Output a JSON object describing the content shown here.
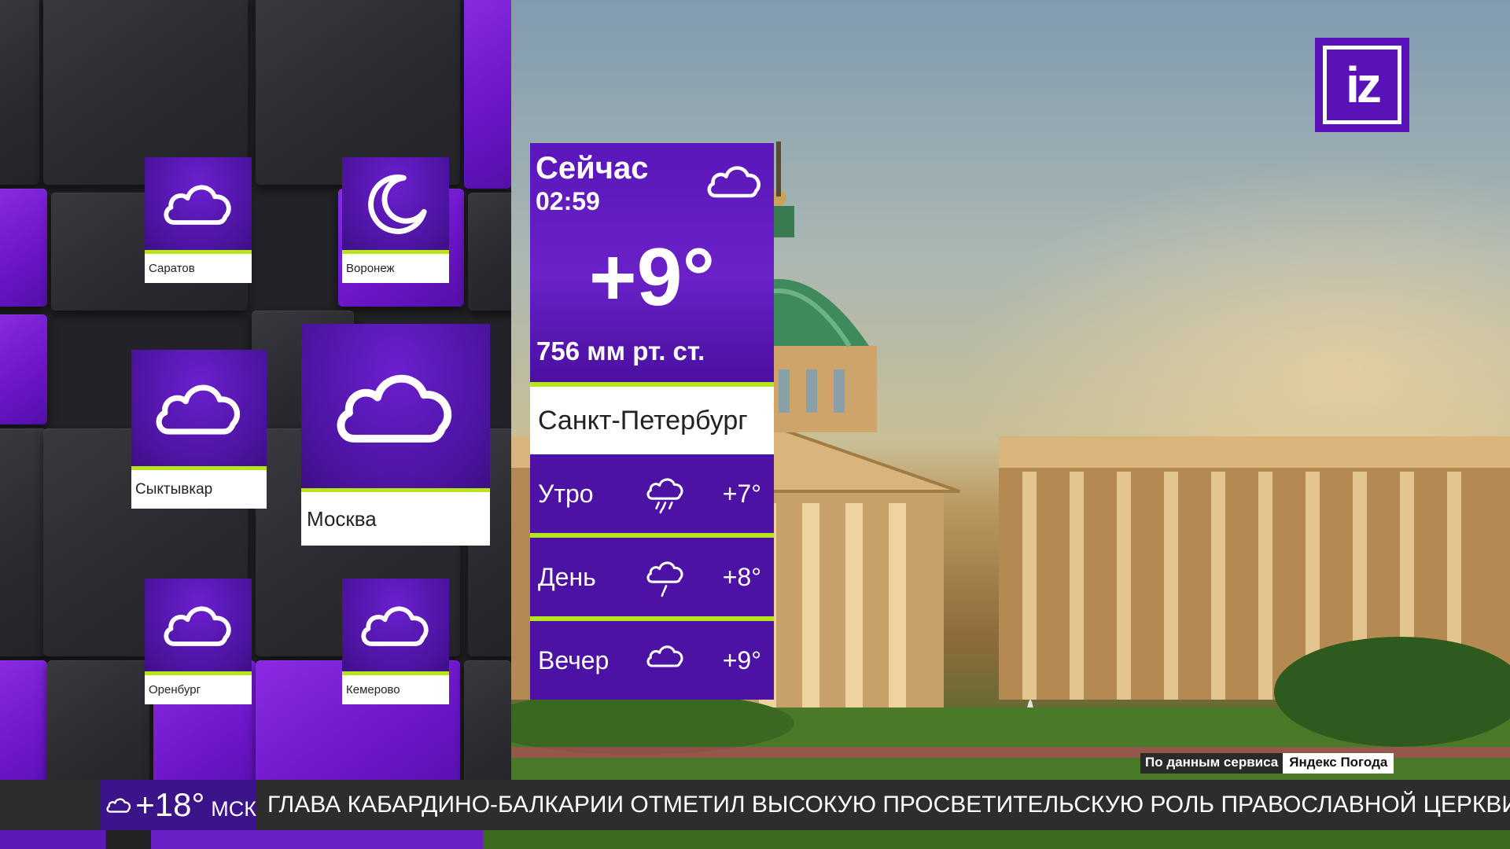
{
  "logo": {
    "text": "iz",
    "color": "#5a11b8"
  },
  "cities": [
    {
      "id": "saratov",
      "name": "Саратов",
      "icon": "cloud-icon"
    },
    {
      "id": "voronezh",
      "name": "Воронеж",
      "icon": "moon-icon"
    },
    {
      "id": "syktyvkar",
      "name": "Сыктывкар",
      "icon": "cloud-icon"
    },
    {
      "id": "moscow",
      "name": "Москва",
      "icon": "cloud-icon"
    },
    {
      "id": "orenburg",
      "name": "Оренбург",
      "icon": "cloud-icon"
    },
    {
      "id": "kemerovo",
      "name": "Кемерово",
      "icon": "cloud-icon"
    }
  ],
  "current": {
    "title": "Сейчас",
    "time": "02:59",
    "icon": "cloud-icon",
    "temperature": "+9°",
    "pressure": "756 мм рт. ст.",
    "city": "Санкт-Петербург"
  },
  "forecast": [
    {
      "label": "Утро",
      "icon": "rain-cloud-icon",
      "temp": "+7°"
    },
    {
      "label": "День",
      "icon": "light-rain-cloud-icon",
      "temp": "+8°"
    },
    {
      "label": "Вечер",
      "icon": "cloud-icon",
      "temp": "+9°"
    }
  ],
  "source": {
    "prefix": "По данным сервиса",
    "service": "Яндекс Погода"
  },
  "ticker": {
    "weather_icon": "cloud-icon",
    "temp": "+18°",
    "city_code": "МСК",
    "headline": "ГЛАВА КАБАРДИНО-БАЛКАРИИ ОТМЕТИЛ ВЫСОКУЮ ПРОСВЕТИТЕЛЬСКУЮ РОЛЬ ПРАВОСЛАВНОЙ ЦЕРКВИ"
  },
  "colors": {
    "accent_purple": "#5a16b8",
    "accent_green": "#b6e51a"
  }
}
